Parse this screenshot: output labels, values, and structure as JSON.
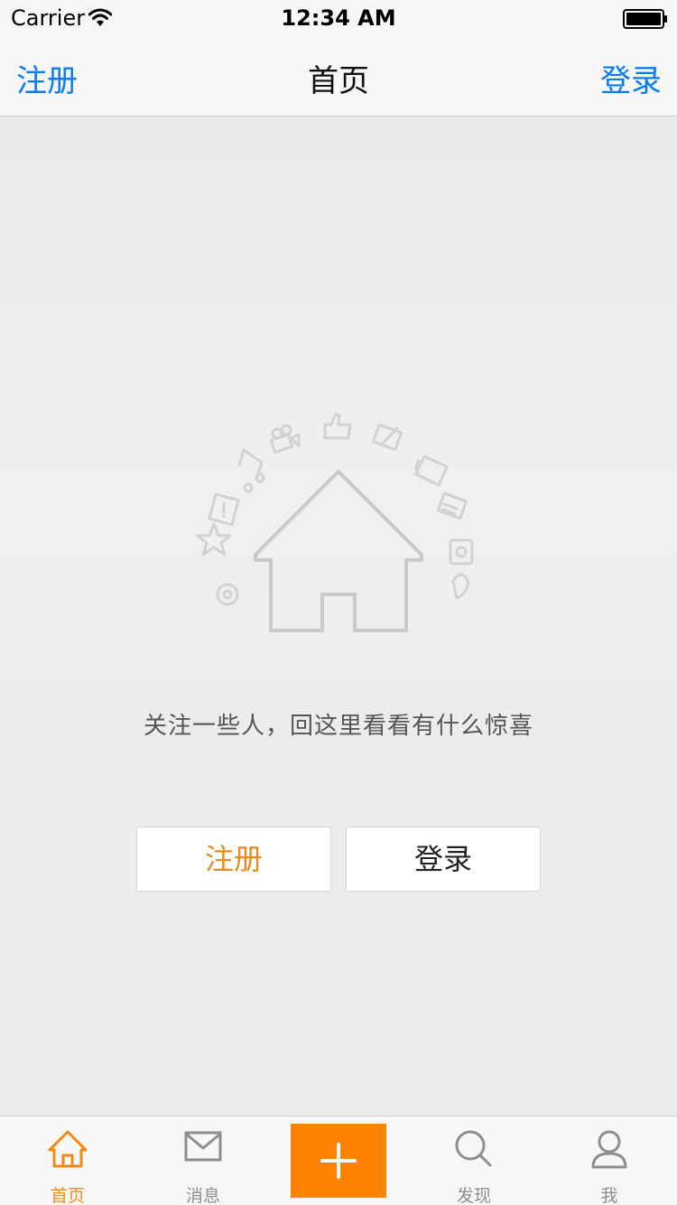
{
  "status_bar": {
    "carrier": "Carrier",
    "time": "12:34 AM",
    "wifi_icon": "wifi-icon",
    "battery_icon": "battery-icon"
  },
  "nav_bar": {
    "left_label": "注册",
    "title": "首页",
    "right_label": "登录",
    "accent_color": "#0a7cf0"
  },
  "main": {
    "illustration_icon": "house-icon",
    "empty_text": "关注一些人，回这里看看有什么惊喜",
    "register_button": "注册",
    "login_button": "登录",
    "register_color": "#e88a1e"
  },
  "tab_bar": {
    "tabs": [
      {
        "label": "首页",
        "icon": "home-icon",
        "active": true
      },
      {
        "label": "消息",
        "icon": "envelope-icon",
        "active": false
      },
      {
        "label": "",
        "icon": "plus-icon",
        "active": false
      },
      {
        "label": "发现",
        "icon": "search-icon",
        "active": false
      },
      {
        "label": "我",
        "icon": "person-icon",
        "active": false
      }
    ],
    "active_color": "#f08a12",
    "compose_color": "#ff8200"
  }
}
